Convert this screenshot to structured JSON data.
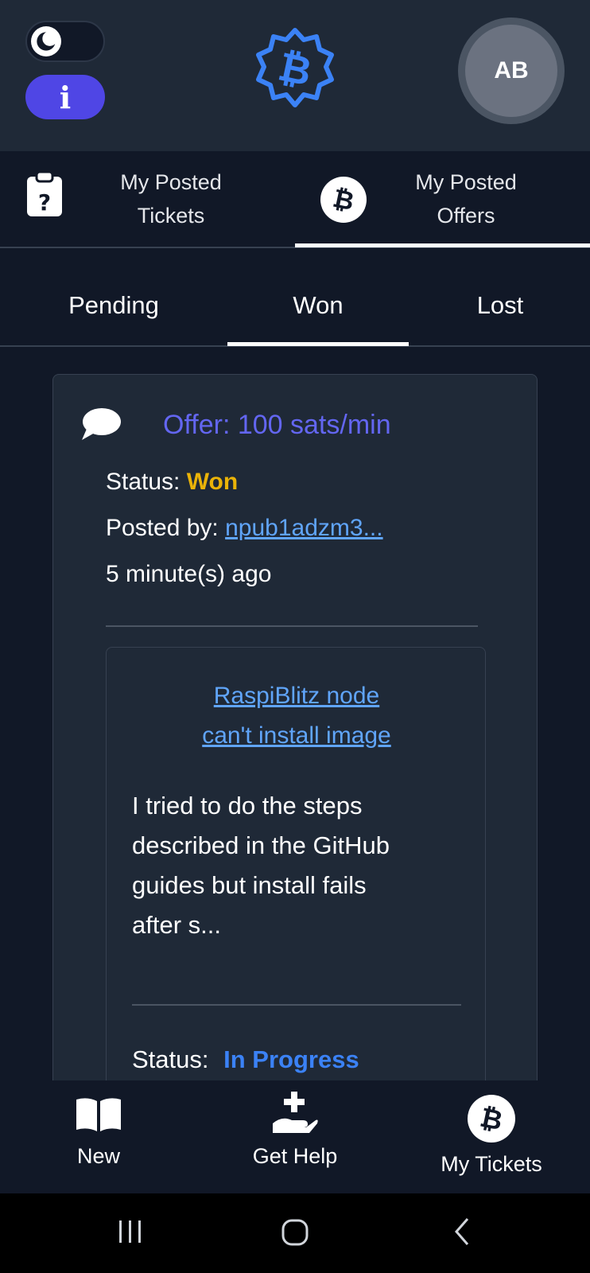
{
  "header": {
    "avatar_initials": "AB",
    "info_label": "i"
  },
  "top_tabs": [
    {
      "label_line1": "My Posted",
      "label_line2": "Tickets",
      "icon": "clipboard-question-icon",
      "active": false
    },
    {
      "label_line1": "My Posted",
      "label_line2": "Offers",
      "icon": "bitcoin-icon",
      "active": true
    }
  ],
  "sub_tabs": [
    {
      "label": "Pending",
      "active": false
    },
    {
      "label": "Won",
      "active": true
    },
    {
      "label": "Lost",
      "active": false
    }
  ],
  "offer": {
    "title": "Offer: 100 sats/min",
    "status_label": "Status:",
    "status_value": "Won",
    "posted_by_label": "Posted by:",
    "posted_by_value": "npub1adzm3...",
    "time_ago": "5 minute(s) ago",
    "ticket": {
      "title_line1": "RaspiBlitz node",
      "title_line2": "can't install image",
      "description": "I tried to do the steps described in the GitHub guides but install fails after s...",
      "status_label": "Status:",
      "status_value": "In Progress"
    }
  },
  "bottom_nav": [
    {
      "label": "New",
      "icon": "book-open-icon"
    },
    {
      "label": "Get Help",
      "icon": "hand-holding-medical-icon"
    },
    {
      "label": "My Tickets",
      "icon": "bitcoin-icon"
    }
  ],
  "colors": {
    "background": "#111827",
    "surface": "#1f2937",
    "accent_indigo": "#6366f1",
    "accent_blue": "#3b82f6",
    "status_won": "#eab308"
  }
}
